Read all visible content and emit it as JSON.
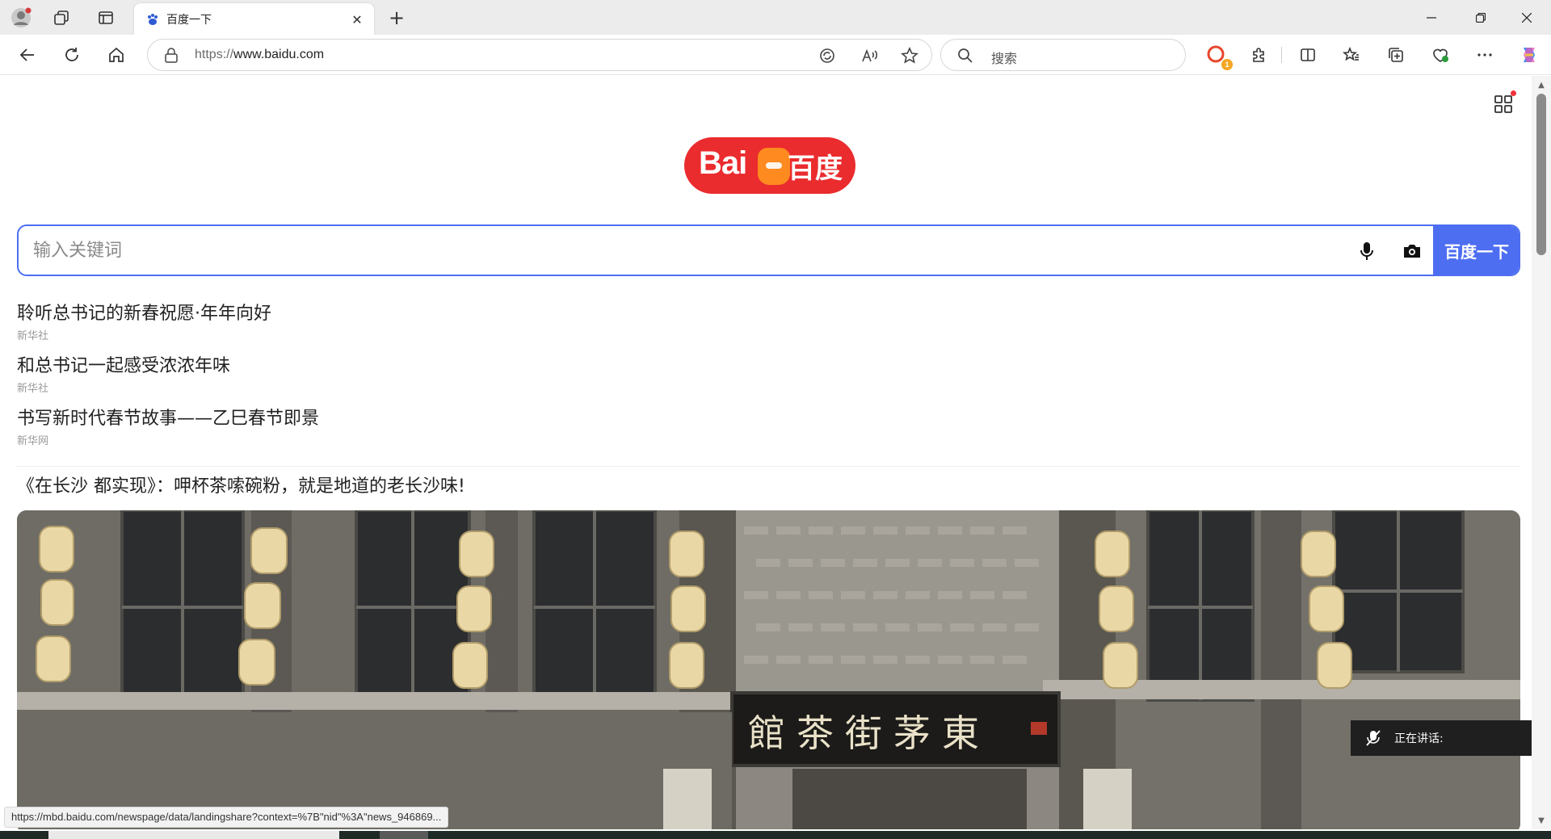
{
  "browser": {
    "tab": {
      "title": "百度一下"
    },
    "address": {
      "url_prefix": "https://",
      "url_host": "www.baidu.com"
    },
    "search_placeholder": "搜索",
    "extension_badge": "1"
  },
  "baidu": {
    "logo": {
      "text_latin": "Bai",
      "text_cn": "百度"
    },
    "search": {
      "placeholder": "输入关键词",
      "button_label": "百度一下"
    },
    "news": [
      {
        "title": "聆听总书记的新春祝愿·年年向好",
        "source": "新华社"
      },
      {
        "title": "和总书记一起感受浓浓年味",
        "source": "新华社"
      },
      {
        "title": "书写新时代春节故事——乙巳春节即景",
        "source": "新华网"
      }
    ],
    "feature": {
      "title": "《在长沙 都实现》：呷杯茶嗦碗粉，就是地道的老长沙味!",
      "sign_text": "館茶街茅東"
    }
  },
  "overlay": {
    "speaking_label": "正在讲话:"
  },
  "status_url": "https://mbd.baidu.com/newspage/data/landingshare?context=%7B\"nid\"%3A\"news_946869..."
}
